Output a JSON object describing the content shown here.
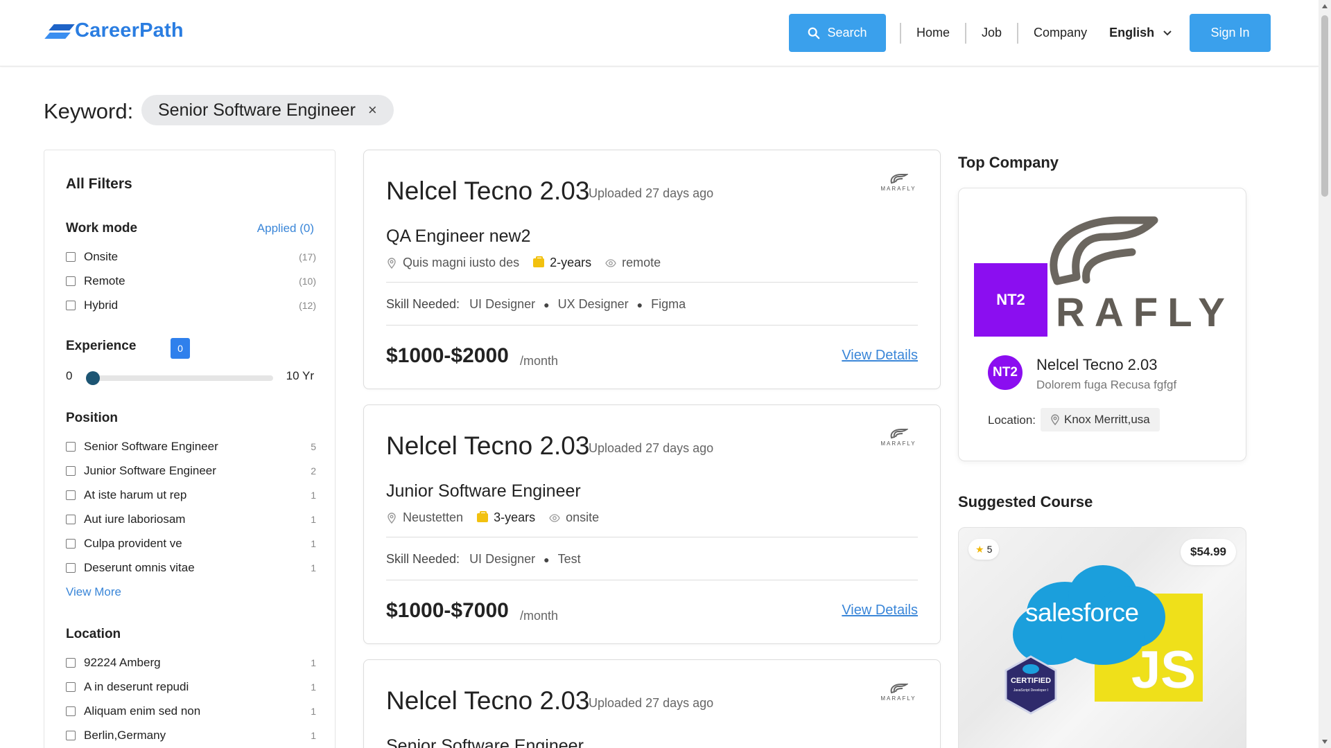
{
  "header": {
    "logo_text": "CareerPath",
    "search_label": "Search",
    "nav": [
      "Home",
      "Job",
      "Company"
    ],
    "language": "English",
    "signin_label": "Sign In"
  },
  "keyword": {
    "label": "Keyword:",
    "value": "Senior Software Engineer",
    "close_glyph": "×"
  },
  "filters": {
    "title": "All Filters",
    "work_mode": {
      "title": "Work mode",
      "applied": "Applied (0)",
      "options": [
        {
          "label": "Onsite",
          "count": "(17)"
        },
        {
          "label": "Remote",
          "count": "(10)"
        },
        {
          "label": "Hybrid",
          "count": "(12)"
        }
      ]
    },
    "experience": {
      "title": "Experience",
      "badge": "0",
      "min_label": "0",
      "max_label": "10 Yr",
      "value": 0
    },
    "position": {
      "title": "Position",
      "options": [
        {
          "label": "Senior Software Engineer",
          "count": "5"
        },
        {
          "label": "Junior Software Engineer",
          "count": "2"
        },
        {
          "label": "At iste harum ut rep",
          "count": "1"
        },
        {
          "label": "Aut iure laboriosam",
          "count": "1"
        },
        {
          "label": "Culpa provident ve",
          "count": "1"
        },
        {
          "label": "Deserunt omnis vitae",
          "count": "1"
        }
      ],
      "view_more": "View More"
    },
    "location": {
      "title": "Location",
      "options": [
        {
          "label": "92224 Amberg",
          "count": "1"
        },
        {
          "label": "A in deserunt repudi",
          "count": "1"
        },
        {
          "label": "Aliquam enim sed non",
          "count": "1"
        },
        {
          "label": "Berlin,Germany",
          "count": "1"
        }
      ]
    }
  },
  "jobs": [
    {
      "company": "Nelcel Tecno 2.03",
      "uploaded": "Uploaded 27 days ago",
      "logo_text": "MARAFLY",
      "title": "QA Engineer new2",
      "location": "Quis magni iusto des",
      "experience": "2-years",
      "mode": "remote",
      "skills_label": "Skill Needed:",
      "skills": [
        "UI Designer",
        "UX Designer",
        "Figma"
      ],
      "salary": "$1000-$2000",
      "per": "/month",
      "details": "View Details"
    },
    {
      "company": "Nelcel Tecno 2.03",
      "uploaded": "Uploaded 27 days ago",
      "logo_text": "MARAFLY",
      "title": "Junior Software Engineer",
      "location": "Neustetten",
      "experience": "3-years",
      "mode": "onsite",
      "skills_label": "Skill Needed:",
      "skills": [
        "UI Designer",
        "Test"
      ],
      "salary": "$1000-$7000",
      "per": "/month",
      "details": "View Details"
    },
    {
      "company": "Nelcel Tecno 2.03",
      "uploaded": "Uploaded 27 days ago",
      "logo_text": "MARAFLY",
      "title": "Senior Software Engineer"
    }
  ],
  "top_company": {
    "title": "Top Company",
    "banner_initials": "NT2",
    "banner_word": "RAFLY",
    "avatar": "NT2",
    "name": "Nelcel Tecno 2.03",
    "description": "Dolorem fuga Recusa fgfgf",
    "location_label": "Location:",
    "location": "Knox Merritt,usa"
  },
  "suggested_course": {
    "title": "Suggested Course",
    "rating": "5",
    "price": "$54.99",
    "brand": "salesforce",
    "js_text": "JS",
    "cert_title": "CERTIFIED",
    "cert_sub": "JavaScript Developer I"
  },
  "colors": {
    "primary": "#3aa0ec",
    "link": "#3a86d8",
    "purple": "#8b0ef0"
  }
}
